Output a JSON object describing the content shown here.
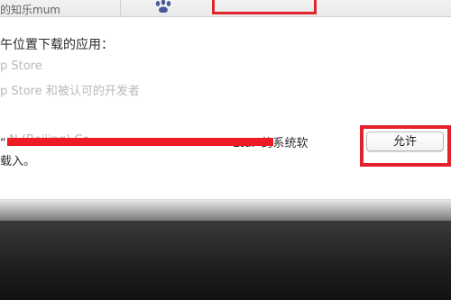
{
  "top": {
    "partial_text": "的知乐mum"
  },
  "section": {
    "heading": "午位置下载的应用：",
    "options": [
      "p Store",
      "p Store 和被认可的开发者"
    ]
  },
  "blocked_message": {
    "prefix": "“",
    "developer_name": "N                                      (Beijing) Co., ",
    "suffix": "Ltd.”的系统软",
    "line2": "载入。"
  },
  "allow_button": {
    "label": "允许"
  },
  "colors": {
    "highlight_red": "#e3212b",
    "redaction_red": "#ee1a24"
  }
}
